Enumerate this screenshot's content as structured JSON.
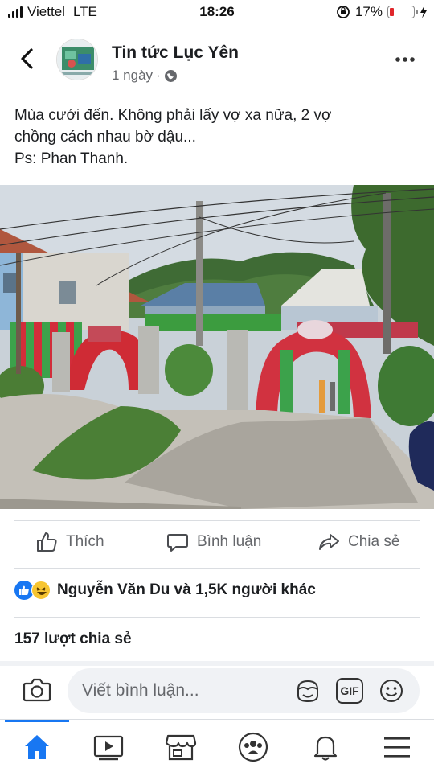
{
  "status_bar": {
    "carrier": "Viettel",
    "network": "LTE",
    "time": "18:26",
    "battery": "17%",
    "battery_level": 0.17
  },
  "post": {
    "page_name": "Tin tức Lục Yên",
    "time_ago": "1 ngày",
    "meta_separator": "·",
    "caption_line1": "Mùa cưới đến. Không phải lấy vợ xa nữa, 2 vợ",
    "caption_line2": "chồng cách nhau bờ dậu...",
    "caption_line3": "Ps: Phan Thanh."
  },
  "actions": {
    "like": "Thích",
    "comment": "Bình luận",
    "share": "Chia sẻ"
  },
  "reactions": {
    "text": "Nguyễn Văn Du và 1,5K người khác",
    "icons": [
      "like-icon",
      "haha-icon"
    ]
  },
  "shares_count": "157 lượt chia sẻ",
  "comment": {
    "placeholder": "Viết bình luận...",
    "gif_label": "GIF"
  },
  "tabs": [
    "home-icon",
    "watch-icon",
    "marketplace-icon",
    "groups-icon",
    "notifications-icon",
    "menu-icon"
  ],
  "colors": {
    "accent": "#1877f2",
    "battery_low": "#e0262b",
    "secondary_text": "#65676b"
  }
}
